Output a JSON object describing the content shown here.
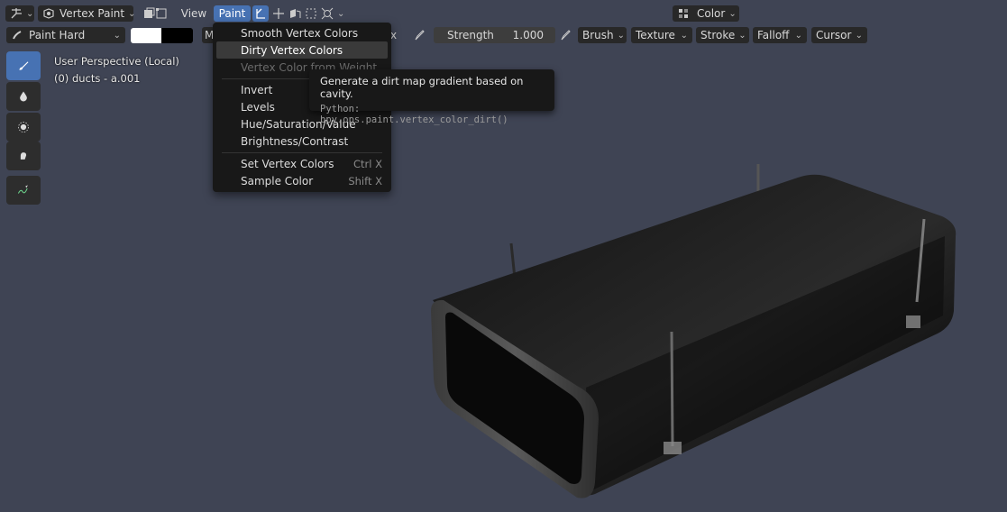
{
  "header": {
    "mode_label": "Vertex Paint",
    "view_label": "View",
    "paint_label": "Paint",
    "color_mode_label": "Color"
  },
  "tool_settings": {
    "brush_name": "Paint Hard",
    "color_primary": "#ffffff",
    "color_secondary": "#000000",
    "blend_fragment": "M",
    "hidden_fragment": "x",
    "strength_label": "Strength",
    "strength_value": "1.000",
    "panels": [
      "Brush",
      "Texture",
      "Stroke",
      "Falloff",
      "Cursor"
    ]
  },
  "viewport": {
    "perspective_label": "User Perspective (Local)",
    "object_label": "(0) ducts - a.001"
  },
  "paint_menu": {
    "items": [
      {
        "label": "Smooth Vertex Colors",
        "shortcut": ""
      },
      {
        "label": "Dirty Vertex Colors",
        "shortcut": ""
      },
      {
        "label": "Vertex Color from Weight",
        "shortcut": ""
      },
      {
        "label": "Invert",
        "shortcut": ""
      },
      {
        "label": "Levels",
        "shortcut": ""
      },
      {
        "label": "Hue/Saturation/Value",
        "shortcut": ""
      },
      {
        "label": "Brightness/Contrast",
        "shortcut": ""
      },
      {
        "label": "Set Vertex Colors",
        "shortcut": "Ctrl X"
      },
      {
        "label": "Sample Color",
        "shortcut": "Shift X"
      }
    ]
  },
  "tooltip": {
    "description": "Generate a dirt map gradient based on cavity.",
    "python": "Python: bpy.ops.paint.vertex_color_dirt()"
  },
  "colors": {
    "accent": "#4772b3",
    "viewport_bg": "#3f4454",
    "menu_bg": "#181818"
  }
}
